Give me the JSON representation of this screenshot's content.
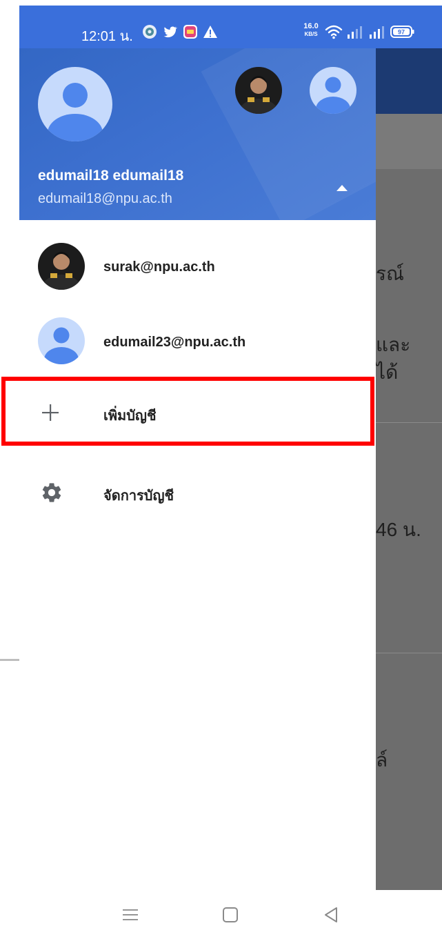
{
  "status_bar": {
    "time": "12:01 น.",
    "network_speed_value": "16.0",
    "network_speed_unit": "KB/S",
    "battery_level": "97",
    "icons": [
      "app-circle-icon",
      "twitter-icon",
      "app-square-icon",
      "warning-icon",
      "wifi-icon",
      "signal-icon",
      "signal-icon",
      "battery-icon"
    ],
    "color": "#3a6fdb"
  },
  "drawer": {
    "header": {
      "account_name": "edumail18 edumail18",
      "account_email": "edumail18@npu.ac.th",
      "color": "#3367c4"
    },
    "accounts": [
      {
        "email": "surak@npu.ac.th",
        "avatar": "photo"
      },
      {
        "email": "edumail23@npu.ac.th",
        "avatar": "default"
      }
    ],
    "actions": {
      "add_account": "เพิ่มบัญชี",
      "manage_accounts": "จัดการบัญชี"
    }
  },
  "background_app": {
    "texts": [
      "รณ์",
      "และ",
      "ได้",
      "46 น.",
      "ล์"
    ]
  },
  "highlight_color": "#ff0000"
}
